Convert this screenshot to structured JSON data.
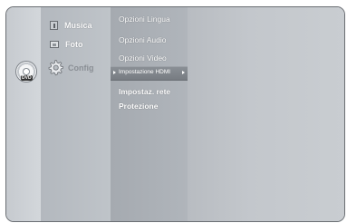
{
  "menu": {
    "items": [
      {
        "label": "Musica",
        "icon": "music-icon",
        "active": false
      },
      {
        "label": "Foto",
        "icon": "photo-icon",
        "active": false
      },
      {
        "label": "Config",
        "icon": "gear-icon",
        "active": true
      }
    ],
    "disc_badge": "DVD"
  },
  "submenu": {
    "items": [
      {
        "label": "Opzioni Lingua"
      },
      {
        "label": "Opzioni Audio"
      },
      {
        "label": "Opzioni Video"
      },
      {
        "label": "Impostazione HDMI",
        "selected": true
      },
      {
        "label": "Impostaz. rete"
      },
      {
        "label": "Protezione"
      }
    ]
  },
  "colors": {
    "panel_bg": "#cdd1d6",
    "highlight": "#82878d",
    "text": "#ffffff",
    "inactive_text": "#8a8f95"
  }
}
